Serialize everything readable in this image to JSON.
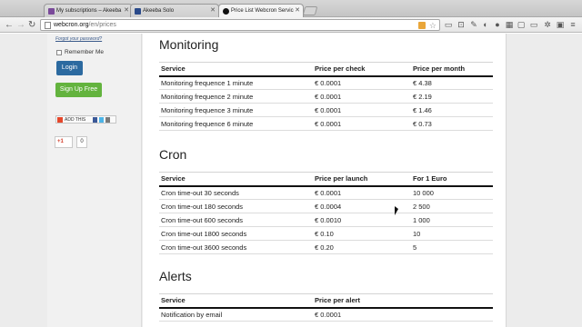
{
  "browser": {
    "tabs": [
      {
        "label": "My subscriptions – Akeeba",
        "active": false,
        "favicon_color": "#7a4a9a"
      },
      {
        "label": "Akeeba Solo",
        "active": false,
        "favicon_color": "#2a4a8a"
      },
      {
        "label": "Price List Webcron Services",
        "active": true,
        "favicon_color": "#111111"
      }
    ],
    "url_host": "webcron.org",
    "url_path": "/en/prices"
  },
  "sidebar": {
    "forgot_password": "Forgot your password?",
    "remember_me": "Remember Me",
    "login_button": "Login",
    "signup_button": "Sign Up Free",
    "addthis_label": "ADD THIS",
    "gplus_label": "+1",
    "gplus_count": "0"
  },
  "sections": {
    "monitoring": {
      "title": "Monitoring",
      "headers": [
        "Service",
        "Price per check",
        "Price per month"
      ],
      "rows": [
        [
          "Monitoring frequence 1 minute",
          "€ 0.0001",
          "€ 4.38"
        ],
        [
          "Monitoring frequence 2 minute",
          "€ 0.0001",
          "€ 2.19"
        ],
        [
          "Monitoring frequence 3 minute",
          "€ 0.0001",
          "€ 1.46"
        ],
        [
          "Monitoring frequence 6 minute",
          "€ 0.0001",
          "€ 0.73"
        ]
      ]
    },
    "cron": {
      "title": "Cron",
      "headers": [
        "Service",
        "Price per launch",
        "For 1 Euro"
      ],
      "rows": [
        [
          "Cron time-out 30 seconds",
          "€ 0.0001",
          "10 000"
        ],
        [
          "Cron time-out 180 seconds",
          "€ 0.0004",
          "2 500"
        ],
        [
          "Cron time-out 600 seconds",
          "€ 0.0010",
          "1 000"
        ],
        [
          "Cron time-out 1800 seconds",
          "€ 0.10",
          "10"
        ],
        [
          "Cron time-out 3600 seconds",
          "€ 0.20",
          "5"
        ]
      ]
    },
    "alerts": {
      "title": "Alerts",
      "headers": [
        "Service",
        "Price per alert"
      ],
      "rows": [
        [
          "Notification by email",
          "€ 0.0001"
        ]
      ]
    }
  }
}
